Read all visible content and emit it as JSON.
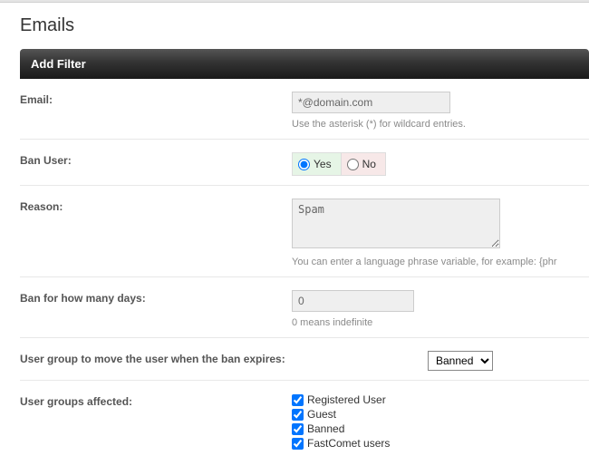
{
  "page": {
    "title": "Emails"
  },
  "panel": {
    "title": "Add Filter"
  },
  "fields": {
    "email": {
      "label": "Email:",
      "value": "*@domain.com",
      "helper": "Use the asterisk (*) for wildcard entries."
    },
    "ban_user": {
      "label": "Ban User:",
      "yes": "Yes",
      "no": "No",
      "selected": "yes"
    },
    "reason": {
      "label": "Reason:",
      "value": "Spam",
      "helper": "You can enter a language phrase variable, for example: {phr"
    },
    "ban_days": {
      "label": "Ban for how many days:",
      "value": "0",
      "helper": "0 means indefinite"
    },
    "expire_group": {
      "label": "User group to move the user when the ban expires:",
      "selected": "Banned",
      "options": [
        "Banned"
      ]
    },
    "groups_affected": {
      "label": "User groups affected:",
      "items": [
        {
          "label": "Registered User",
          "checked": true
        },
        {
          "label": "Guest",
          "checked": true
        },
        {
          "label": "Banned",
          "checked": true
        },
        {
          "label": "FastComet users",
          "checked": true
        }
      ]
    }
  }
}
